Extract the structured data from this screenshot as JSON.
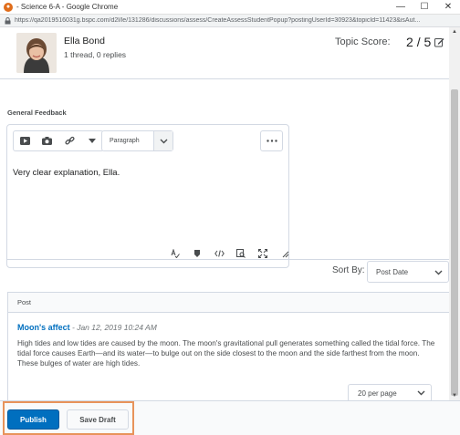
{
  "window": {
    "title": "- Science 6-A - Google Chrome",
    "url": "https://qa2019516031g.bspc.com/d2l/le/131286/discussions/assess/CreateAssessStudentPopup?postingUserId=30923&topicId=11423&isAut..."
  },
  "icons": {
    "app": "chrome-icon",
    "lock": "lock-icon",
    "minimize": "minimize-icon",
    "maximize": "maximize-icon",
    "close": "close-icon"
  },
  "user": {
    "name": "Ella Bond",
    "meta": "1 thread, 0 replies"
  },
  "score": {
    "label": "Topic Score:",
    "value": "2",
    "separator": "/",
    "out_of": "5"
  },
  "feedback": {
    "label": "General Feedback",
    "format": "Paragraph",
    "text": "Very clear explanation, Ella."
  },
  "sort": {
    "label": "Sort By:",
    "value": "Post Date"
  },
  "posts": {
    "header": "Post",
    "items": [
      {
        "title": "Moon's affect",
        "date": " - Jan 12, 2019 10:24 AM",
        "body": "High tides and low tides are caused by the moon. The moon's gravitational pull generates something called the tidal force. The tidal force causes Earth—and its water—to bulge out on the side closest to the moon and the side farthest from the moon. These bulges of water are high tides."
      }
    ]
  },
  "pagination": {
    "per_page": "20 per page"
  },
  "footer": {
    "publish": "Publish",
    "save_draft": "Save Draft"
  },
  "colors": {
    "primary": "#006fbf",
    "highlight": "#e8935a"
  }
}
